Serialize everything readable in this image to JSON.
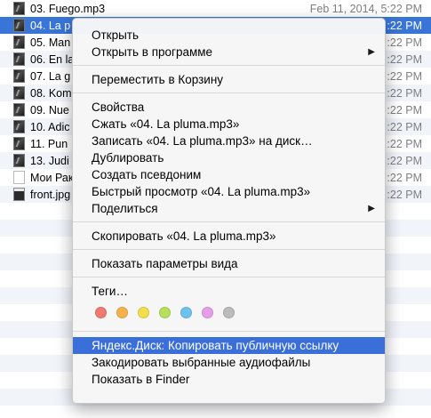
{
  "files": [
    {
      "name": "03. Fuego.mp3",
      "date": "Feb 11, 2014, 5:22 PM",
      "icon": "audio-file-icon",
      "selected": false
    },
    {
      "name": "04. La p",
      "date": ":22 PM",
      "icon": "audio-file-icon",
      "selected": true
    },
    {
      "name": "05. Man",
      "date": ":22 PM",
      "icon": "audio-file-icon",
      "selected": false
    },
    {
      "name": "06. En la",
      "date": ":22 PM",
      "icon": "audio-file-icon",
      "selected": false
    },
    {
      "name": "07. La g",
      "date": ":22 PM",
      "icon": "audio-file-icon",
      "selected": false
    },
    {
      "name": "08. Kom",
      "date": ":22 PM",
      "icon": "audio-file-icon",
      "selected": false
    },
    {
      "name": "09. Nue",
      "date": ":22 PM",
      "icon": "audio-file-icon",
      "selected": false
    },
    {
      "name": "10. Adic",
      "date": ":22 PM",
      "icon": "audio-file-icon",
      "selected": false
    },
    {
      "name": "11. Pun",
      "date": ":22 PM",
      "icon": "audio-file-icon",
      "selected": false
    },
    {
      "name": "13. Judi",
      "date": ":22 PM",
      "icon": "audio-file-icon",
      "selected": false
    },
    {
      "name": "Мои Рак",
      "date": ":22 PM",
      "icon": "document-file-icon",
      "selected": false
    },
    {
      "name": "front.jpg",
      "date": ":22 PM",
      "icon": "image-file-icon",
      "selected": false
    }
  ],
  "context_menu": {
    "groups": [
      [
        {
          "label": "Открыть",
          "submenu": false
        },
        {
          "label": "Открыть в программе",
          "submenu": true
        }
      ],
      [
        {
          "label": "Переместить в Корзину",
          "submenu": false
        }
      ],
      [
        {
          "label": "Свойства",
          "submenu": false
        },
        {
          "label": "Сжать «04. La pluma.mp3»",
          "submenu": false
        },
        {
          "label": "Записать «04. La pluma.mp3» на диск…",
          "submenu": false
        },
        {
          "label": "Дублировать",
          "submenu": false
        },
        {
          "label": "Создать псевдоним",
          "submenu": false
        },
        {
          "label": "Быстрый просмотр «04. La pluma.mp3»",
          "submenu": false
        },
        {
          "label": "Поделиться",
          "submenu": true
        }
      ],
      [
        {
          "label": "Скопировать «04. La pluma.mp3»",
          "submenu": false
        }
      ],
      [
        {
          "label": "Показать параметры вида",
          "submenu": false
        }
      ],
      [
        {
          "label": "Теги…",
          "submenu": false
        }
      ]
    ],
    "tag_colors": [
      {
        "name": "red",
        "color": "#f07a72"
      },
      {
        "name": "orange",
        "color": "#f6b24a"
      },
      {
        "name": "yellow",
        "color": "#f2dd4a"
      },
      {
        "name": "green",
        "color": "#b6e05a"
      },
      {
        "name": "blue",
        "color": "#6cc4ee"
      },
      {
        "name": "purple",
        "color": "#e79ee8"
      },
      {
        "name": "gray",
        "color": "#bcbcbc"
      }
    ],
    "bottom_items": [
      {
        "label": "Яндекс.Диск: Копировать публичную ссылку",
        "highlighted": true
      },
      {
        "label": "Закодировать выбранные аудиофайлы",
        "highlighted": false
      },
      {
        "label": "Показать в Finder",
        "highlighted": false
      }
    ]
  },
  "colors": {
    "selection": "#3875d7",
    "menu_highlight": "#3a6fd9"
  }
}
